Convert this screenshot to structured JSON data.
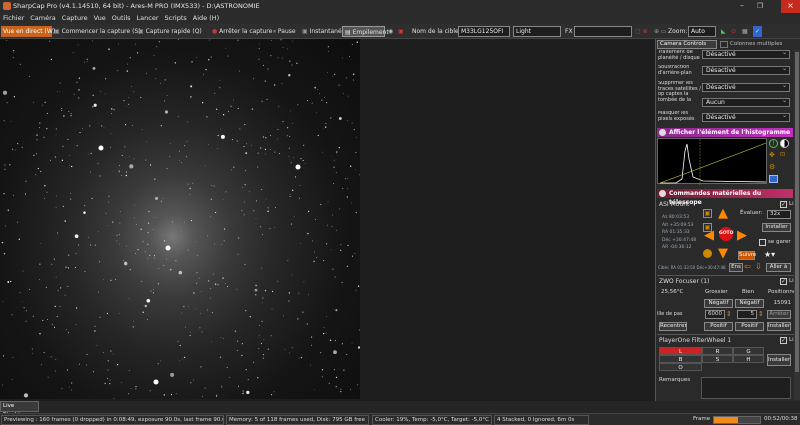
{
  "window": {
    "title": "SharpCap Pro (v4.1.14510, 64 bit) - Ares-M PRO (IMX533) - D:\\ASTRONOMIE"
  },
  "menu": [
    "Fichier",
    "Caméra",
    "Capture",
    "Vue",
    "Outils",
    "Lancer",
    "Scripts",
    "Aide (H)"
  ],
  "toolbar": {
    "live_view": "Vue en direct (W)",
    "start_capture": "Commencer la capture (S)",
    "quick_capture": "Capture rapide (Q)",
    "stop_capture": "Arrêter la capture",
    "pause": "Pause",
    "snapshot": "Instantané",
    "stacking": "Empilement",
    "target_label": "Nom de la cible:",
    "target_value": "M33LG125OFI",
    "frame_type": "Light",
    "fx_label": "FX",
    "zoom_label": "Zoom:",
    "zoom_value": "Auto"
  },
  "panel": {
    "camera_controls_tab": "Camera Controls",
    "multi_column": "Colonnes multiples",
    "rows": [
      {
        "label": "Traitement de planéité / disque",
        "value": "Désactivé"
      },
      {
        "label": "Soustraction d'arrière-plan",
        "value": "Désactivé"
      },
      {
        "label": "Supprimer les traces satellites / op captes la tombée de la",
        "value": "Désactivé"
      },
      {
        "label": "",
        "value": "Aucun"
      },
      {
        "label": "Masquer les pixels exposés",
        "value": "Désactivé"
      }
    ],
    "histogram_header": "Afficher l'élément de l'histogramme",
    "telescope_header": "Commandes matérielles du télescope",
    "mount": {
      "name": "ASI Mount",
      "connected": "Lié",
      "coords": [
        "Az 80:03:53",
        "Alt +35:09:53",
        "RA 01:35:33",
        "Déc +30:47:48",
        "AR -04:36:12"
      ],
      "goto": "GOTO",
      "evaluate": "Évaluer:",
      "speed": "32x",
      "install": "Installer",
      "se_garer": "se garer",
      "suivre": "Suivre",
      "ens": "Ens",
      "aller": "Aller à",
      "status": "Cible: RA 01:33:50  Déc+30:47:48"
    },
    "focuser": {
      "name": "ZWO Focuser (1)",
      "connected": "Lié",
      "temp": "25,56°C",
      "coarse": "Grossier",
      "fine": "Bien",
      "position_label": "Positionner",
      "neg1": "Négatif",
      "neg2": "Négatif",
      "position": "15091",
      "step_label": "ille de pas",
      "step": "6000",
      "fine_step": "5",
      "stop": "Arrêter",
      "recenter": "Recentrer",
      "pos1": "Positif",
      "pos2": "Positif",
      "install": "Installer"
    },
    "filterwheel": {
      "name": "PlayerOne FilterWheel 1",
      "connected": "Lié",
      "filters": [
        "L",
        "R",
        "G",
        "B",
        "S",
        "H",
        "O"
      ],
      "install": "Installer"
    },
    "remarks": "Remarques"
  },
  "live_stacking_tab": "Live Stacking",
  "status": {
    "preview": "Previewing : 160 frames (0 dropped) in 0:08:49, exposure 90.0s, last frame 90.0s",
    "memory": "Memory: 5 of 118 frames used, Disk: 795 GB free",
    "cooler": "Cooler: 19%, Temp: -5,0°C, Target: -5,0°C",
    "stacked": "4 Stacked, 0 Ignored, 6m 0s",
    "frame_label": "Frame",
    "frame_progress": 0.52,
    "frame_time": "00:52/00:38"
  }
}
